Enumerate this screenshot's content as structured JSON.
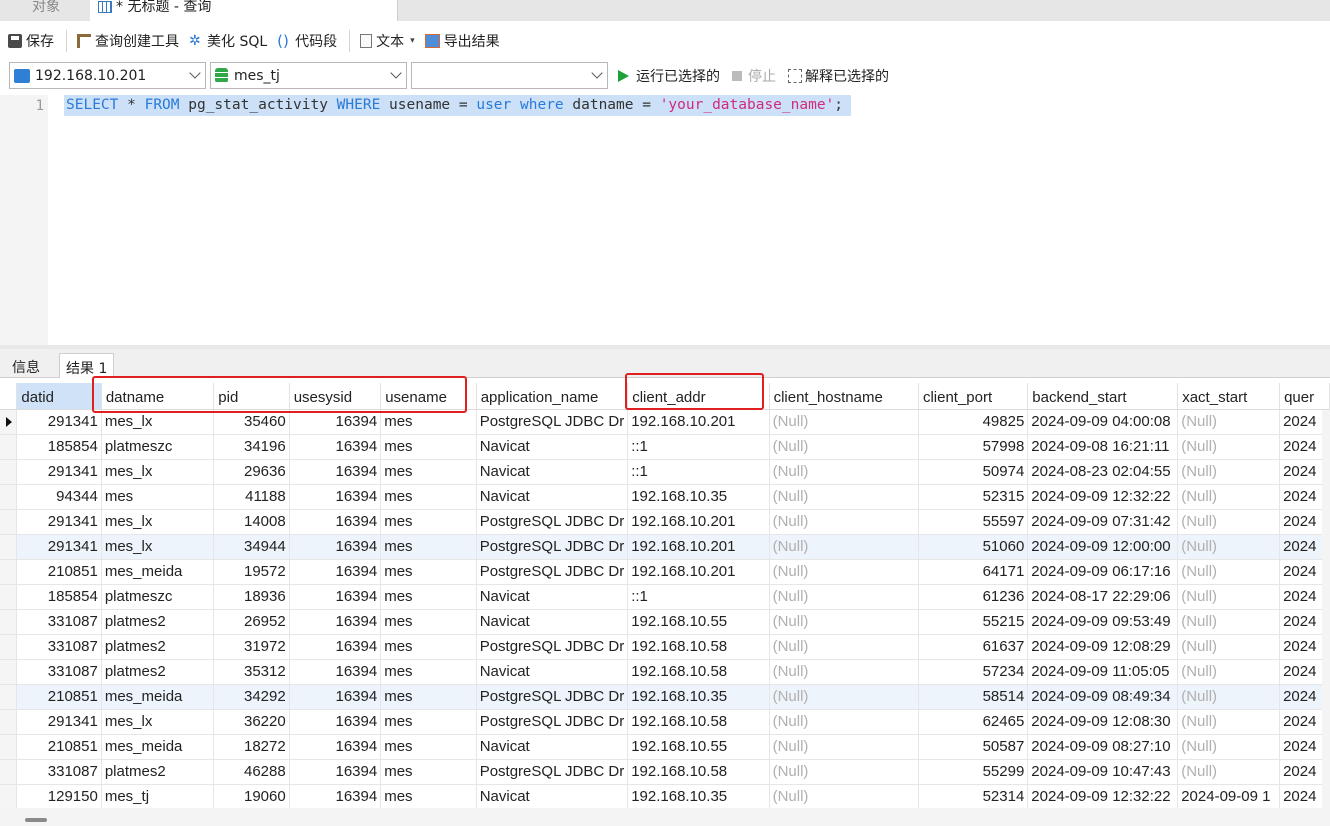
{
  "tabs": {
    "objects": "对象",
    "query": "* 无标题 - 查询"
  },
  "toolbar": {
    "save": "保存",
    "query_builder": "查询创建工具",
    "beautify": "美化 SQL",
    "snippet": "代码段",
    "text": "文本",
    "export": "导出结果"
  },
  "connection": {
    "host": "192.168.10.201",
    "database": "mes_tj",
    "schema": ""
  },
  "actions": {
    "run_selected": "运行已选择的",
    "stop": "停止",
    "explain_selected": "解释已选择的"
  },
  "editor": {
    "line_number": "1",
    "tokens": [
      {
        "t": "SELECT",
        "c": "kw"
      },
      {
        "t": " * ",
        "c": "plain"
      },
      {
        "t": "FROM",
        "c": "kw"
      },
      {
        "t": " pg_stat_activity ",
        "c": "plain"
      },
      {
        "t": "WHERE",
        "c": "kw"
      },
      {
        "t": " usename = ",
        "c": "plain"
      },
      {
        "t": "user",
        "c": "kw"
      },
      {
        "t": " ",
        "c": "plain"
      },
      {
        "t": "where",
        "c": "kw"
      },
      {
        "t": " datname = ",
        "c": "plain"
      },
      {
        "t": "'your_database_name'",
        "c": "str"
      },
      {
        "t": ";",
        "c": "plain"
      }
    ]
  },
  "result_tabs": [
    "信息",
    "结果 1"
  ],
  "colors": {
    "highlight_border": "#e02020",
    "selection": "#cce0f7"
  },
  "grid": {
    "columns": [
      "datid",
      "datname",
      "pid",
      "usesysid",
      "usename",
      "application_name",
      "client_addr",
      "client_hostname",
      "client_port",
      "backend_start",
      "xact_start",
      "quer"
    ],
    "rows": [
      [
        "291341",
        "mes_lx",
        "35460",
        "16394",
        "mes",
        "PostgreSQL JDBC Dr",
        "192.168.10.201",
        "(Null)",
        "49825",
        "2024-09-09 04:00:08",
        "(Null)",
        "2024"
      ],
      [
        "185854",
        "platmeszc",
        "34196",
        "16394",
        "mes",
        "Navicat",
        "::1",
        "(Null)",
        "57998",
        "2024-09-08 16:21:11",
        "(Null)",
        "2024"
      ],
      [
        "291341",
        "mes_lx",
        "29636",
        "16394",
        "mes",
        "Navicat",
        "::1",
        "(Null)",
        "50974",
        "2024-08-23 02:04:55",
        "(Null)",
        "2024"
      ],
      [
        "94344",
        "mes",
        "41188",
        "16394",
        "mes",
        "Navicat",
        "192.168.10.35",
        "(Null)",
        "52315",
        "2024-09-09 12:32:22",
        "(Null)",
        "2024"
      ],
      [
        "291341",
        "mes_lx",
        "14008",
        "16394",
        "mes",
        "PostgreSQL JDBC Dr",
        "192.168.10.201",
        "(Null)",
        "55597",
        "2024-09-09 07:31:42",
        "(Null)",
        "2024"
      ],
      [
        "291341",
        "mes_lx",
        "34944",
        "16394",
        "mes",
        "PostgreSQL JDBC Dr",
        "192.168.10.201",
        "(Null)",
        "51060",
        "2024-09-09 12:00:00",
        "(Null)",
        "2024"
      ],
      [
        "210851",
        "mes_meida",
        "19572",
        "16394",
        "mes",
        "PostgreSQL JDBC Dr",
        "192.168.10.201",
        "(Null)",
        "64171",
        "2024-09-09 06:17:16",
        "(Null)",
        "2024"
      ],
      [
        "185854",
        "platmeszc",
        "18936",
        "16394",
        "mes",
        "Navicat",
        "::1",
        "(Null)",
        "61236",
        "2024-08-17 22:29:06",
        "(Null)",
        "2024"
      ],
      [
        "331087",
        "platmes2",
        "26952",
        "16394",
        "mes",
        "Navicat",
        "192.168.10.55",
        "(Null)",
        "55215",
        "2024-09-09 09:53:49",
        "(Null)",
        "2024"
      ],
      [
        "331087",
        "platmes2",
        "31972",
        "16394",
        "mes",
        "PostgreSQL JDBC Dr",
        "192.168.10.58",
        "(Null)",
        "61637",
        "2024-09-09 12:08:29",
        "(Null)",
        "2024"
      ],
      [
        "331087",
        "platmes2",
        "35312",
        "16394",
        "mes",
        "Navicat",
        "192.168.10.58",
        "(Null)",
        "57234",
        "2024-09-09 11:05:05",
        "(Null)",
        "2024"
      ],
      [
        "210851",
        "mes_meida",
        "34292",
        "16394",
        "mes",
        "PostgreSQL JDBC Dr",
        "192.168.10.35",
        "(Null)",
        "58514",
        "2024-09-09 08:49:34",
        "(Null)",
        "2024"
      ],
      [
        "291341",
        "mes_lx",
        "36220",
        "16394",
        "mes",
        "PostgreSQL JDBC Dr",
        "192.168.10.58",
        "(Null)",
        "62465",
        "2024-09-09 12:08:30",
        "(Null)",
        "2024"
      ],
      [
        "210851",
        "mes_meida",
        "18272",
        "16394",
        "mes",
        "Navicat",
        "192.168.10.55",
        "(Null)",
        "50587",
        "2024-09-09 08:27:10",
        "(Null)",
        "2024"
      ],
      [
        "331087",
        "platmes2",
        "46288",
        "16394",
        "mes",
        "PostgreSQL JDBC Dr",
        "192.168.10.58",
        "(Null)",
        "55299",
        "2024-09-09 10:47:43",
        "(Null)",
        "2024"
      ],
      [
        "129150",
        "mes_tj",
        "19060",
        "16394",
        "mes",
        "Navicat",
        "192.168.10.35",
        "(Null)",
        "52314",
        "2024-09-09 12:32:22",
        "2024-09-09 1",
        "2024"
      ]
    ]
  }
}
